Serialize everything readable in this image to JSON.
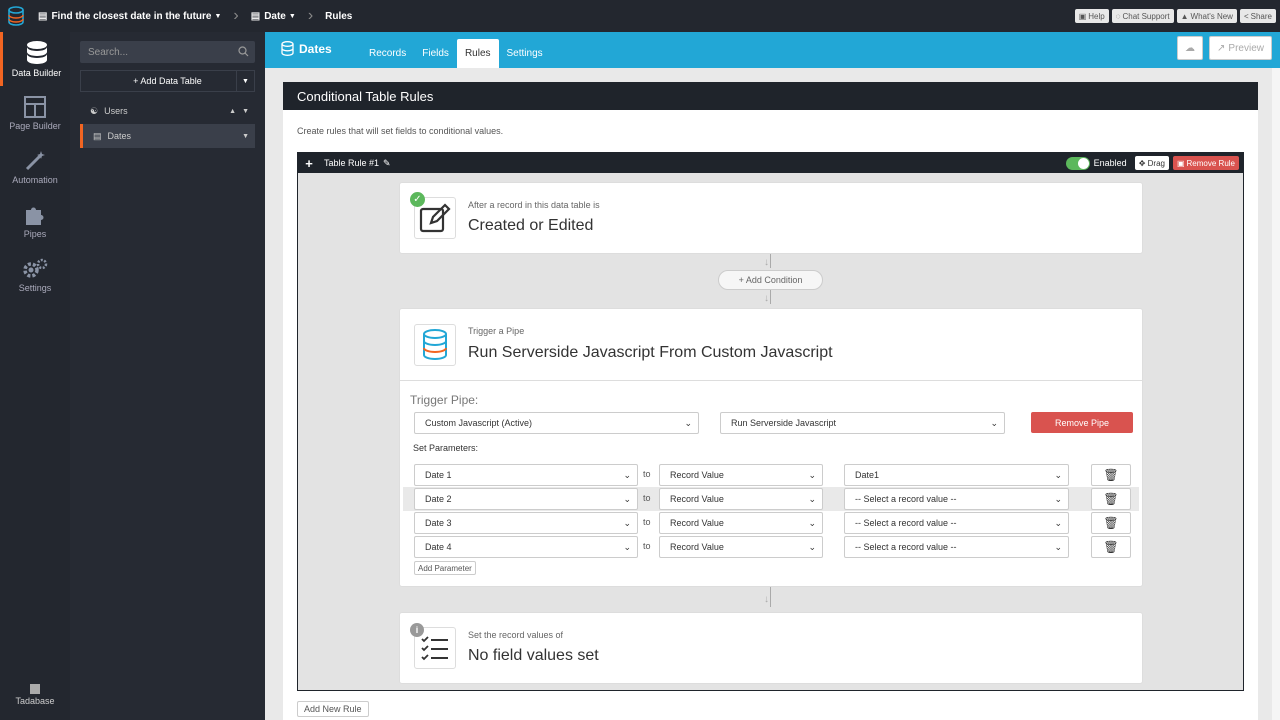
{
  "topbar": {
    "app_name": "Find the closest date in the future",
    "crumb_table": "Date",
    "crumb_page": "Rules",
    "help": "Help",
    "chat": "Chat Support",
    "whats_new": "What's New",
    "share": "Share"
  },
  "leftnav": {
    "items": [
      {
        "label": "Data Builder",
        "icon": "database-icon"
      },
      {
        "label": "Page Builder",
        "icon": "layout-icon"
      },
      {
        "label": "Automation",
        "icon": "magic-wand-icon"
      },
      {
        "label": "Pipes",
        "icon": "puzzle-icon"
      },
      {
        "label": "Settings",
        "icon": "gear-icon"
      }
    ],
    "footer": "Tadabase"
  },
  "sidebar": {
    "search_placeholder": "Search...",
    "add_table": "+ Add Data Table",
    "tables": [
      "Users",
      "Dates"
    ]
  },
  "header": {
    "title": "Dates",
    "tabs": [
      "Records",
      "Fields",
      "Rules",
      "Settings"
    ],
    "active_tab": "Rules",
    "preview": "Preview"
  },
  "panel": {
    "title": "Conditional Table Rules",
    "description": "Create rules that will set fields to conditional values."
  },
  "rule": {
    "title": "Table Rule #1",
    "enabled": "Enabled",
    "drag": "Drag",
    "remove": "Remove Rule",
    "trigger_sub": "After a record in this data table is",
    "trigger_main": "Created or Edited",
    "add_condition": "+ Add Condition",
    "pipe_sub": "Trigger a Pipe",
    "pipe_main": "Run Serverside Javascript From Custom Javascript",
    "trigger_pipe_label": "Trigger Pipe:",
    "pipe_select": "Custom Javascript (Active)",
    "action_select": "Run Serverside Javascript",
    "remove_pipe": "Remove Pipe",
    "set_params_label": "Set Parameters:",
    "to": "to",
    "params": [
      {
        "field": "Date 1",
        "type": "Record Value",
        "value": "Date1"
      },
      {
        "field": "Date 2",
        "type": "Record Value",
        "value": "-- Select a record value --"
      },
      {
        "field": "Date 3",
        "type": "Record Value",
        "value": "-- Select a record value --"
      },
      {
        "field": "Date 4",
        "type": "Record Value",
        "value": "-- Select a record value --"
      }
    ],
    "add_parameter": "Add Parameter",
    "values_sub": "Set the record values of",
    "values_main": "No field values set"
  },
  "footer": {
    "add_rule": "Add New Rule"
  },
  "colors": {
    "topbar": "#23272f",
    "accent_blue": "#22a7d6",
    "accent_orange": "#f26522",
    "danger": "#d9534f",
    "success": "#5cb85c"
  }
}
